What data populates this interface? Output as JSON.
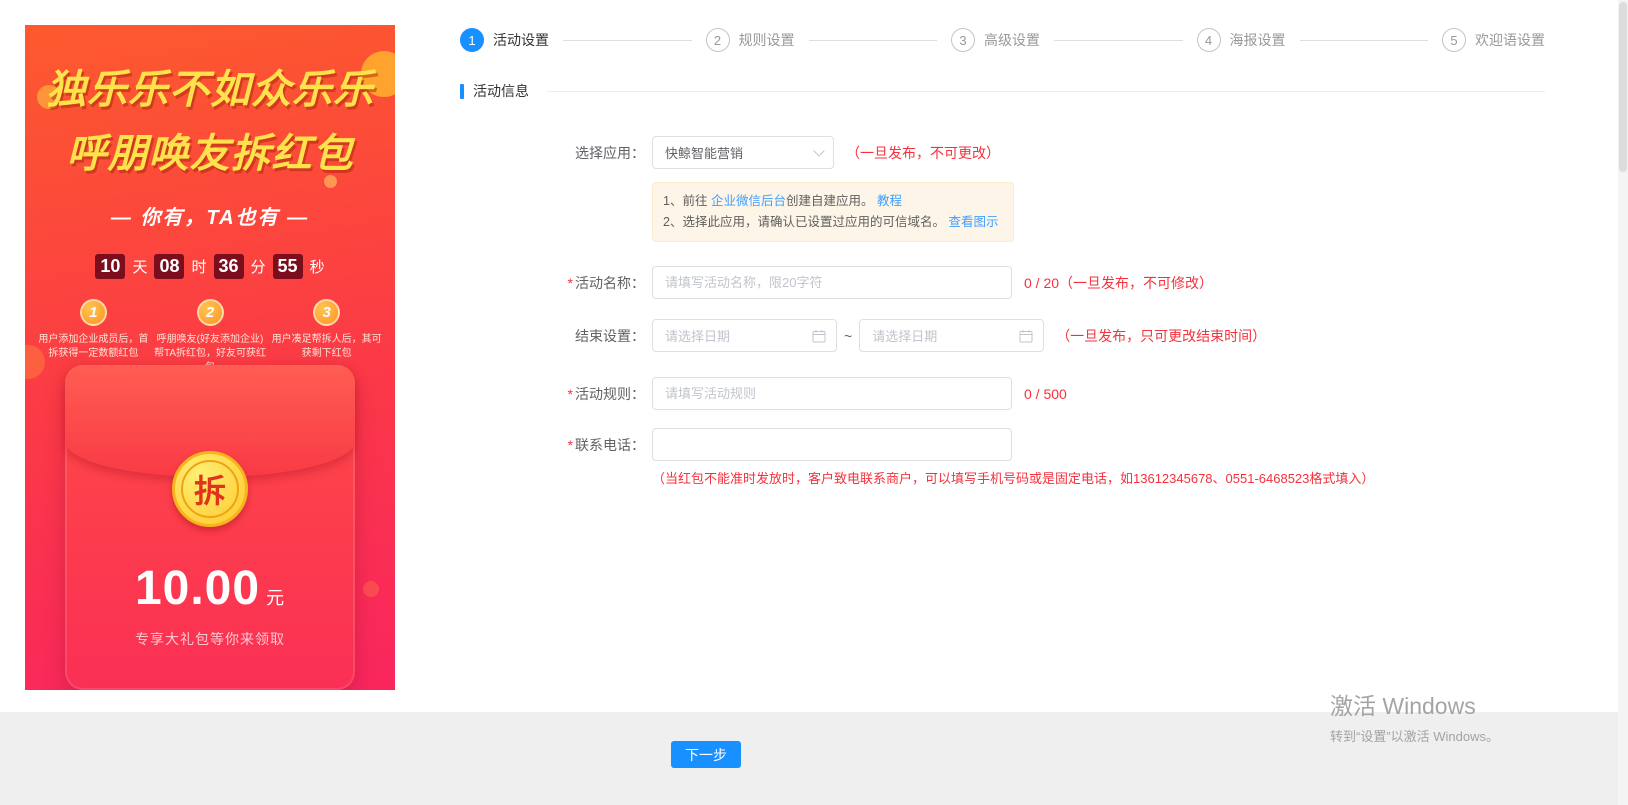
{
  "colors": {
    "accent": "#1890ff",
    "link": "#409eff",
    "danger": "#f5313d"
  },
  "poster": {
    "title_line1": "独乐乐不如众乐乐",
    "title_line2": "呼朋唤友拆红包",
    "subtitle": "— 你有，TA也有 —",
    "countdown": [
      {
        "value": "10",
        "unit": "天"
      },
      {
        "value": "08",
        "unit": "时"
      },
      {
        "value": "36",
        "unit": "分"
      },
      {
        "value": "55",
        "unit": "秒"
      }
    ],
    "steps": [
      {
        "num": "1",
        "text": "用户添加企业成员后，首拆获得一定数额红包"
      },
      {
        "num": "2",
        "text": "呼朋唤友(好友添加企业) 帮TA拆红包，好友可获红包"
      },
      {
        "num": "3",
        "text": "用户凑足帮拆人后，其可获剩下红包"
      }
    ],
    "envelope": {
      "coin_char": "拆",
      "amount": "10.00",
      "unit": "元",
      "note": "专享大礼包等你来领取"
    }
  },
  "wizard": {
    "steps": [
      {
        "num": "1",
        "label": "活动设置"
      },
      {
        "num": "2",
        "label": "规则设置"
      },
      {
        "num": "3",
        "label": "高级设置"
      },
      {
        "num": "4",
        "label": "海报设置"
      },
      {
        "num": "5",
        "label": "欢迎语设置"
      }
    ]
  },
  "section": {
    "title": "活动信息"
  },
  "form": {
    "app": {
      "label": "选择应用：",
      "value": "快鲸智能营销",
      "note": "（一旦发布，不可更改）",
      "tips": {
        "line1_prefix": "1、前往 ",
        "line1_link1": "企业微信后台",
        "line1_mid": "创建自建应用。",
        "line1_link2": "教程",
        "line2_prefix": "2、选择此应用，请确认已设置过应用的可信域名。",
        "line2_link": "查看图示"
      }
    },
    "name": {
      "required": "*",
      "label": "活动名称：",
      "placeholder": "请填写活动名称，限20字符",
      "counter": "0 / 20（一旦发布，不可修改）"
    },
    "end": {
      "label": "结束设置：",
      "placeholder_start": "请选择日期",
      "separator": "~",
      "placeholder_end": "请选择日期",
      "note": "（一旦发布，只可更改结束时间）"
    },
    "rules": {
      "required": "*",
      "label": "活动规则：",
      "placeholder": "请填写活动规则",
      "counter": "0 / 500"
    },
    "phone": {
      "required": "*",
      "label": "联系电话：",
      "note": "（当红包不能准时发放时，客户致电联系商户，可以填写手机号码或是固定电话，如13612345678、0551-6468523格式填入）"
    }
  },
  "footer": {
    "next_button": "下一步"
  },
  "watermark": {
    "line1": "激活 Windows",
    "line2": "转到“设置”以激活 Windows。"
  }
}
